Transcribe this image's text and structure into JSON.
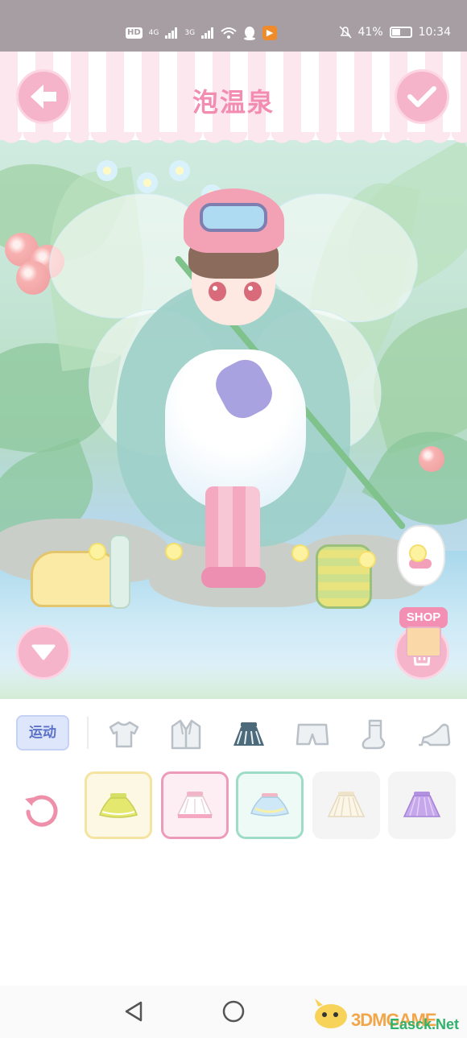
{
  "status_bar": {
    "hd_label": "HD",
    "sim1_label": "4G",
    "sim2_label": "3G",
    "battery_percent": "41%",
    "time": "10:34",
    "icons": [
      "wifi-icon",
      "qq-icon",
      "video-app-icon",
      "mute-bell-icon",
      "battery-icon"
    ]
  },
  "scene": {
    "title": "泡温泉",
    "back_icon": "arrow-left-icon",
    "confirm_icon": "checkmark-icon",
    "scroll_down_icon": "chevron-down-icon",
    "delete_icon": "trash-icon",
    "shop_label": "SHOP"
  },
  "tool_panel": {
    "category_label": "运动",
    "tabs": [
      {
        "name": "top",
        "icon": "tshirt-icon",
        "selected": false
      },
      {
        "name": "coat",
        "icon": "jacket-icon",
        "selected": false
      },
      {
        "name": "skirt",
        "icon": "skirt-icon",
        "selected": true
      },
      {
        "name": "pants",
        "icon": "shorts-icon",
        "selected": false
      },
      {
        "name": "socks",
        "icon": "sock-icon",
        "selected": false
      },
      {
        "name": "shoes",
        "icon": "heel-icon",
        "selected": false
      }
    ],
    "reset_icon": "refresh-icon",
    "items": [
      {
        "name": "yellow-green tutu skirt",
        "color": "#e5e86e",
        "frame": "yellow"
      },
      {
        "name": "white pink-hem skirt",
        "color": "#ffffff",
        "frame": "pink"
      },
      {
        "name": "blue frilled skirt",
        "color": "#cfe8f8",
        "frame": "green"
      },
      {
        "name": "cream pleated skirt",
        "color": "#fbf6e8",
        "frame": "none"
      },
      {
        "name": "lavender pleated skirt",
        "color": "#c7a7ec",
        "frame": "none"
      }
    ]
  },
  "nav_bar": {
    "icons": [
      "back-triangle-icon",
      "home-circle-icon"
    ]
  },
  "watermark": {
    "brand": "3DMGAME",
    "sub": "Easck.Net"
  },
  "colors": {
    "accent_pink": "#f28cb0",
    "button_pink": "#f6b4cb",
    "chip_blue": "#5c72c8",
    "status_bar": "#a69ea3"
  }
}
